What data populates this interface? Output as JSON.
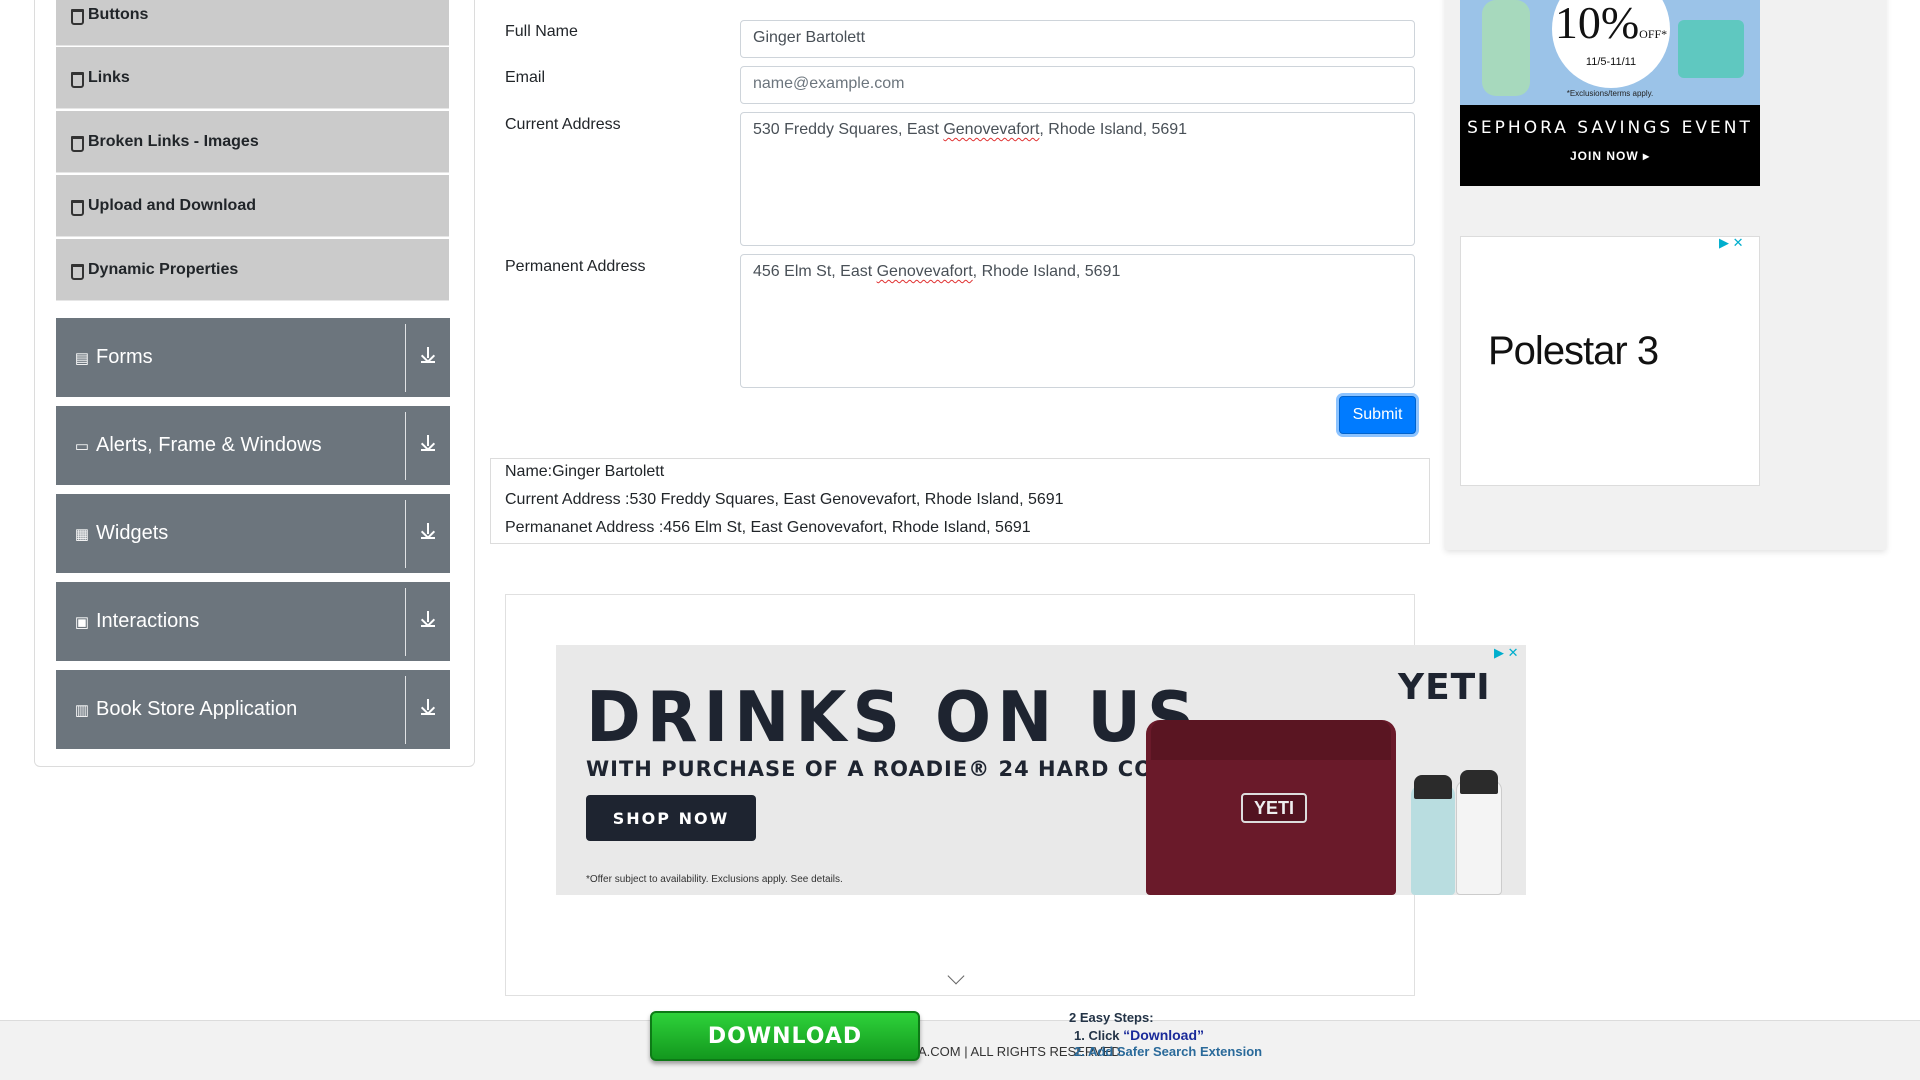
{
  "sidebar": {
    "sub_items": [
      {
        "label": "Buttons"
      },
      {
        "label": "Links"
      },
      {
        "label": "Broken Links - Images"
      },
      {
        "label": "Upload and Download"
      },
      {
        "label": "Dynamic Properties"
      }
    ],
    "groups": [
      {
        "label": "Forms",
        "icon": "form-icon"
      },
      {
        "label": "Alerts, Frame & Windows",
        "icon": "window-icon"
      },
      {
        "label": "Widgets",
        "icon": "widgets-icon"
      },
      {
        "label": "Interactions",
        "icon": "interactions-icon"
      },
      {
        "label": "Book Store Application",
        "icon": "books-icon"
      }
    ]
  },
  "form": {
    "full_name": {
      "label": "Full Name",
      "value": "Ginger Bartolett"
    },
    "email": {
      "label": "Email",
      "placeholder": "name@example.com"
    },
    "current_address": {
      "label": "Current Address",
      "pre": "530 Freddy Squares, East ",
      "misspelled": "Genovevafort",
      "post": ", Rhode Island, 5691"
    },
    "permanent_address": {
      "label": "Permanent Address",
      "pre": "456 Elm St, East ",
      "misspelled": "Genovevafort",
      "post": ", Rhode Island, 5691"
    },
    "submit_label": "Submit"
  },
  "output": {
    "name": "Name:Ginger Bartolett",
    "current_address": "Current Address :530 Freddy Squares, East Genovevafort, Rhode Island, 5691",
    "permanent_address": "Permananet Address :456 Elm St, East Genovevafort, Rhode Island, 5691"
  },
  "ads": {
    "yeti": {
      "headline": "DRINKS ON US",
      "subline": "WITH PURCHASE OF A ROADIE® 24 HARD COOLER.*",
      "cta": "SHOP NOW",
      "fine_print": "*Offer subject to availability. Exclusions apply. See details.",
      "brand": "YETI"
    },
    "sephora": {
      "discount": "10%",
      "off": "OFF*",
      "dates": "11/5-11/11",
      "exclusions": "*Exclusions/terms apply.",
      "title": "SEPHORA SAVINGS EVENT",
      "cta": "JOIN NOW ▸"
    },
    "polestar": {
      "text": "Polestar 3"
    }
  },
  "footer": {
    "text": "A.COM | ALL RIGHTS RESERVED.",
    "download_label": "DOWNLOAD",
    "steps_title": "2 Easy Steps:",
    "step1_prefix": "1. Click ",
    "step1_highlight": "“Download”",
    "step2": "2. Add Safer Search Extension"
  },
  "colors": {
    "accent": "#007bff",
    "group_bg": "#6c757d",
    "sub_item_bg": "#cbcbcb",
    "download_green": "#1fb82b"
  }
}
